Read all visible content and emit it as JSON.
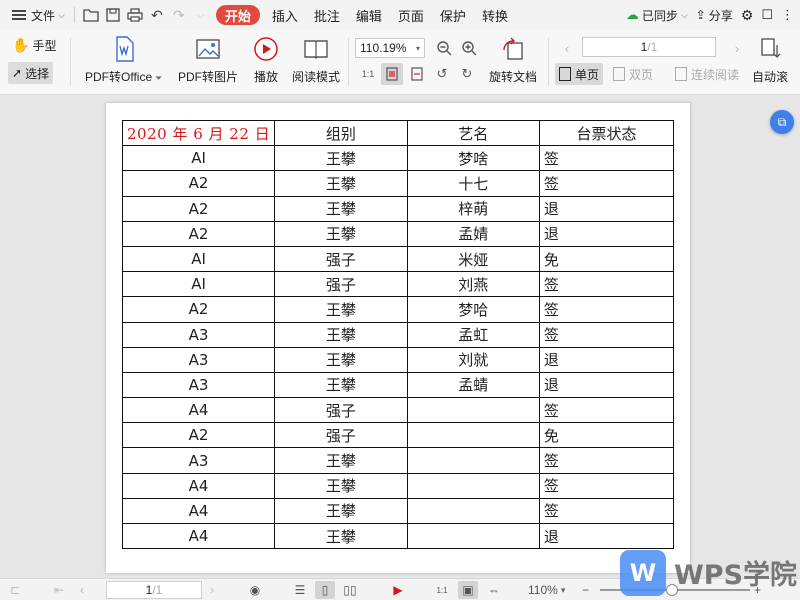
{
  "menubar": {
    "file_label": "文件",
    "tabs": [
      "开始",
      "插入",
      "批注",
      "编辑",
      "页面",
      "保护",
      "转换"
    ],
    "active_tab": "开始",
    "sync_label": "已同步",
    "share_label": "分享"
  },
  "ribbon": {
    "hand_label": "手型",
    "select_label": "选择",
    "pdf_to_office": "PDF转Office",
    "pdf_to_image": "PDF转图片",
    "play": "播放",
    "read_mode": "阅读模式",
    "zoom_value": "110.19%",
    "rotate_doc": "旋转文档",
    "page_current": "1",
    "page_total": "/1",
    "single_page": "单页",
    "double_page": "双页",
    "continuous_read": "连续阅读",
    "auto_scroll": "自动滚"
  },
  "document": {
    "handwritten_date": "2020 年 6 月 22 日",
    "headers": [
      "组别",
      "艺名",
      "台票状态"
    ],
    "rows": [
      [
        "AI",
        "王攀",
        "梦啥",
        "签"
      ],
      [
        "A2",
        "王攀",
        "十七",
        "签"
      ],
      [
        "A2",
        "王攀",
        "梓萌",
        "退"
      ],
      [
        "A2",
        "王攀",
        "孟婧",
        "退"
      ],
      [
        "AI",
        "强子",
        "米娅",
        "免"
      ],
      [
        "AI",
        "强子",
        "刘燕",
        "签"
      ],
      [
        "A2",
        "王攀",
        "梦哈",
        "签"
      ],
      [
        "A3",
        "王攀",
        "孟虹",
        "签"
      ],
      [
        "A3",
        "王攀",
        "刘就",
        "退"
      ],
      [
        "A3",
        "王攀",
        "孟蜻",
        "退"
      ],
      [
        "A4",
        "强子",
        "",
        "签"
      ],
      [
        "A2",
        "强子",
        "",
        "免"
      ],
      [
        "A3",
        "王攀",
        "",
        "签"
      ],
      [
        "A4",
        "王攀",
        "",
        "签"
      ],
      [
        "A4",
        "王攀",
        "",
        "签"
      ],
      [
        "A4",
        "王攀",
        "",
        "退"
      ]
    ]
  },
  "statusbar": {
    "page_current": "1",
    "page_total": "/1",
    "zoom": "110%"
  },
  "watermark": {
    "logo_letter": "W",
    "text": "WPS学院"
  },
  "colors": {
    "active_tab": "#e04b3d",
    "handwriting": "#d8161b",
    "float_button": "#3f7fe8",
    "sync": "#2aa34a"
  }
}
